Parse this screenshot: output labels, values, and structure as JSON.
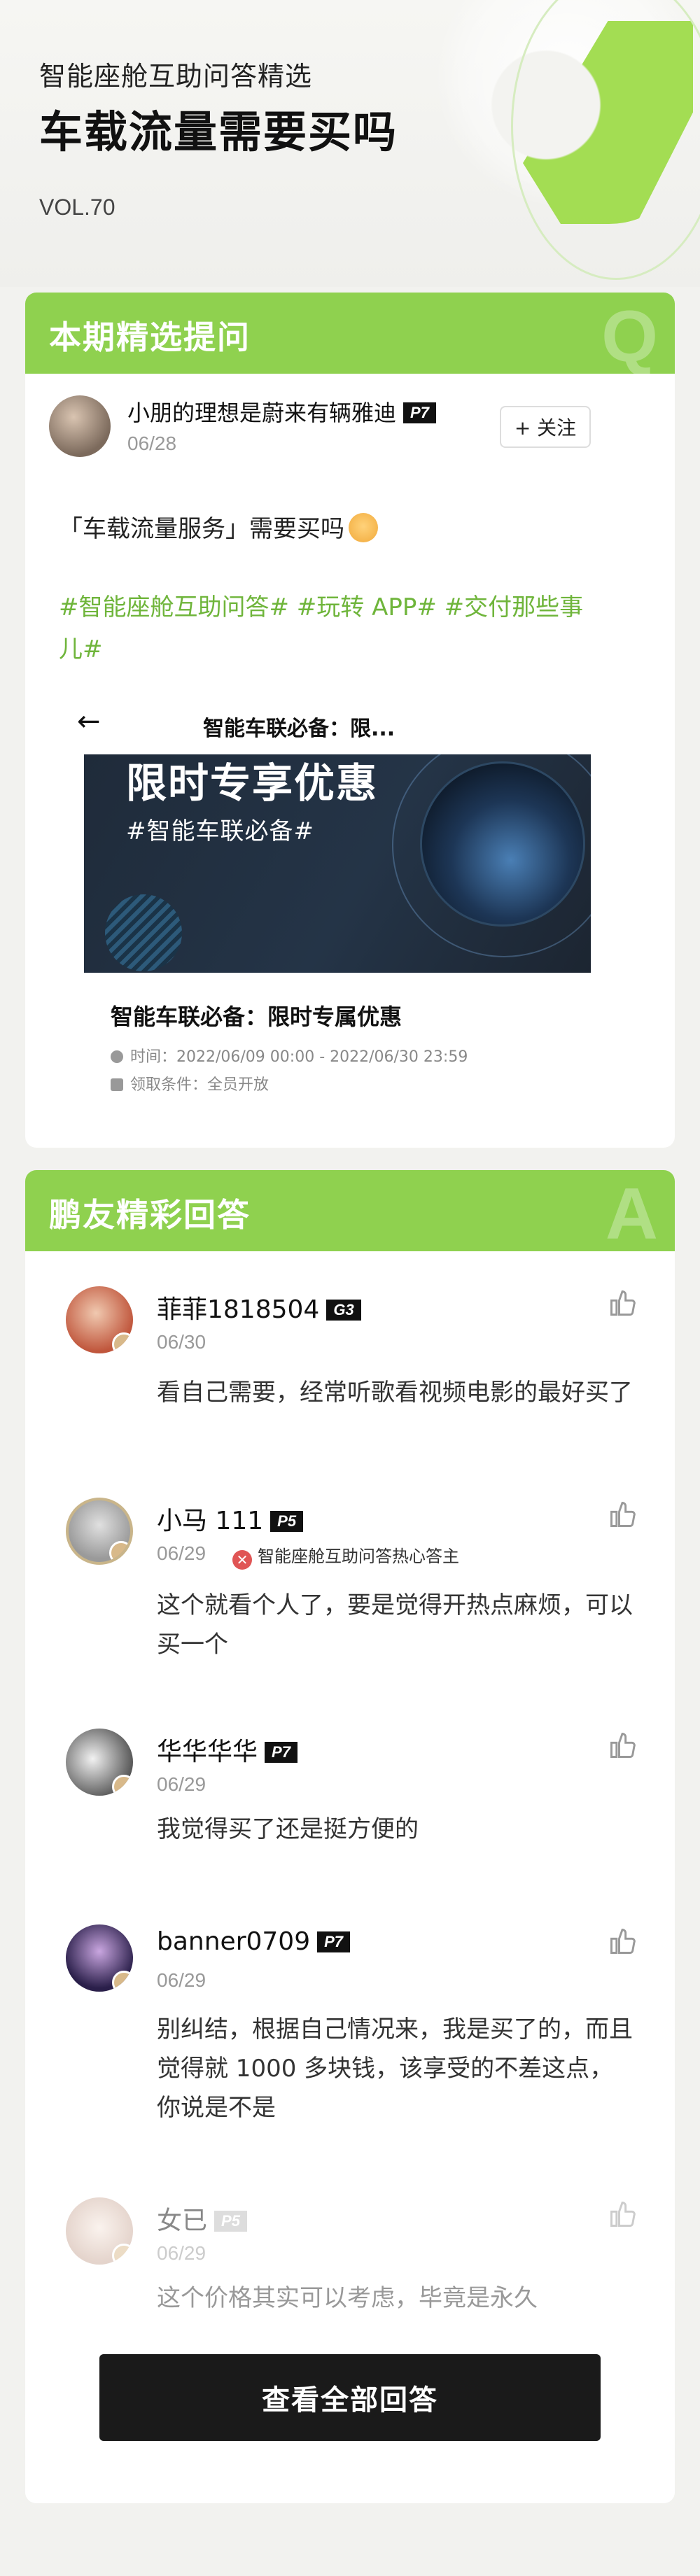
{
  "header": {
    "subtitle": "智能座舱互助问答精选",
    "title": "车载流量需要买吗",
    "volume": "VOL.70"
  },
  "question_section": {
    "heading": "本期精选提问",
    "letter": "Q",
    "user": {
      "name": "小朋的理想是蔚来有辆雅迪",
      "level": "P7",
      "date": "06/28"
    },
    "follow_label": "+ 关注",
    "question": "「车载流量服务」需要买吗",
    "tags": "#智能座舱互助问答# #玩转 APP# #交付那些事儿#",
    "embed": {
      "back_icon": "←",
      "title": "智能车联必备：限...",
      "banner_title": "限时专享优惠",
      "banner_subtitle": "#智能车联必备#",
      "promo_title": "智能车联必备：限时专属优惠",
      "time_line": "时间：2022/06/09 00:00 - 2022/06/30 23:59",
      "condition_line": "领取条件：全员开放"
    }
  },
  "answers_section": {
    "heading": "鹏友精彩回答",
    "letter": "A",
    "answers": [
      {
        "name": "菲菲1818504",
        "level": "G3",
        "date": "06/30",
        "text": "看自己需要，经常听歌看视频电影的最好买了"
      },
      {
        "name": "小马 111",
        "level": "P5",
        "date": "06/29",
        "hot_tag": "智能座舱互助问答热心答主",
        "text": "这个就看个人了，要是觉得开热点麻烦，可以买一个"
      },
      {
        "name": "华华华华",
        "level": "P7",
        "date": "06/29",
        "text": "我觉得买了还是挺方便的"
      },
      {
        "name": "banner0709",
        "level": "P7",
        "date": "06/29",
        "text": "别纠结，根据自己情况来，我是买了的，而且觉得就 1000 多块钱，该享受的不差这点，你说是不是"
      },
      {
        "name": "女已",
        "level": "P5",
        "date": "06/29",
        "text": "这个价格其实可以考虑，毕竟是永久"
      }
    ],
    "view_all_label": "查看全部回答"
  },
  "colors": {
    "brand_green": "#8fd14f",
    "tag_green": "#6fb53b",
    "dark": "#1a1a1a"
  }
}
